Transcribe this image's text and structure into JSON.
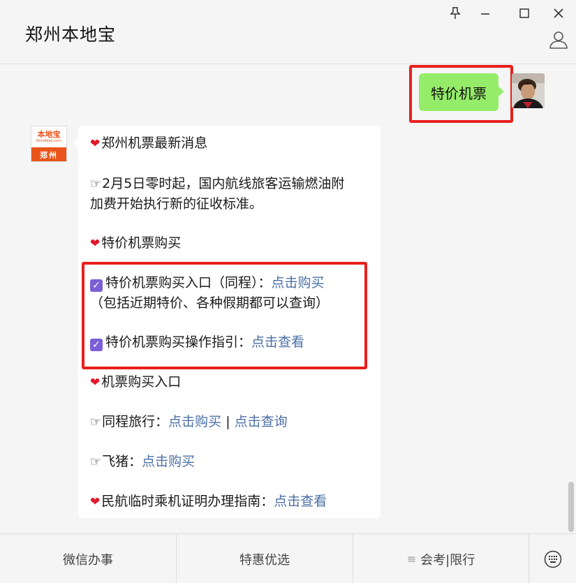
{
  "window": {
    "title": "郑州本地宝",
    "pin_icon": "pin-icon",
    "minimize_icon": "minimize-icon",
    "maximize_icon": "maximize-icon",
    "close_icon": "close-icon",
    "profile_icon": "person-icon"
  },
  "user_message": {
    "text": "特价机票"
  },
  "bot": {
    "avatar": {
      "logo_text": "本地宝",
      "logo_sub": "Bendibao.com",
      "city": "郑州"
    },
    "lines": {
      "l1_text": "郑州机票最新消息",
      "l2_text": "2月5日零时起，国内航线旅客运输燃油附",
      "l3_text": "加费开始执行新的征收标准。",
      "l4_text": "特价机票购买",
      "l5_text": "特价机票购买入口（同程）：",
      "l5_link": "点击购买",
      "l6_text": "（包括近期特价、各种假期都可以查询）",
      "l7_text": "特价机票购买操作指引：",
      "l7_link": "点击查看",
      "l8_text": "机票购买入口",
      "l9_text": "同程旅行：",
      "l9_link1": "点击购买",
      "l9_sep": " | ",
      "l9_link2": "点击查询",
      "l10_text": "飞猪：",
      "l10_link": "点击购买",
      "l11_text": "民航临时乘机证明办理指南：",
      "l11_link": "点击查看"
    }
  },
  "menu": {
    "items": [
      {
        "label": "微信办事"
      },
      {
        "label": "特惠优选"
      },
      {
        "label": "会考|限行",
        "icon": "menu-lines-icon"
      }
    ],
    "keyboard_icon": "keyboard-icon"
  },
  "colors": {
    "user_bubble": "#95ec69",
    "link": "#4a6fa5",
    "highlight": "#e8201c",
    "checkbox": "#7b5fd6",
    "brand": "#e9541a"
  }
}
